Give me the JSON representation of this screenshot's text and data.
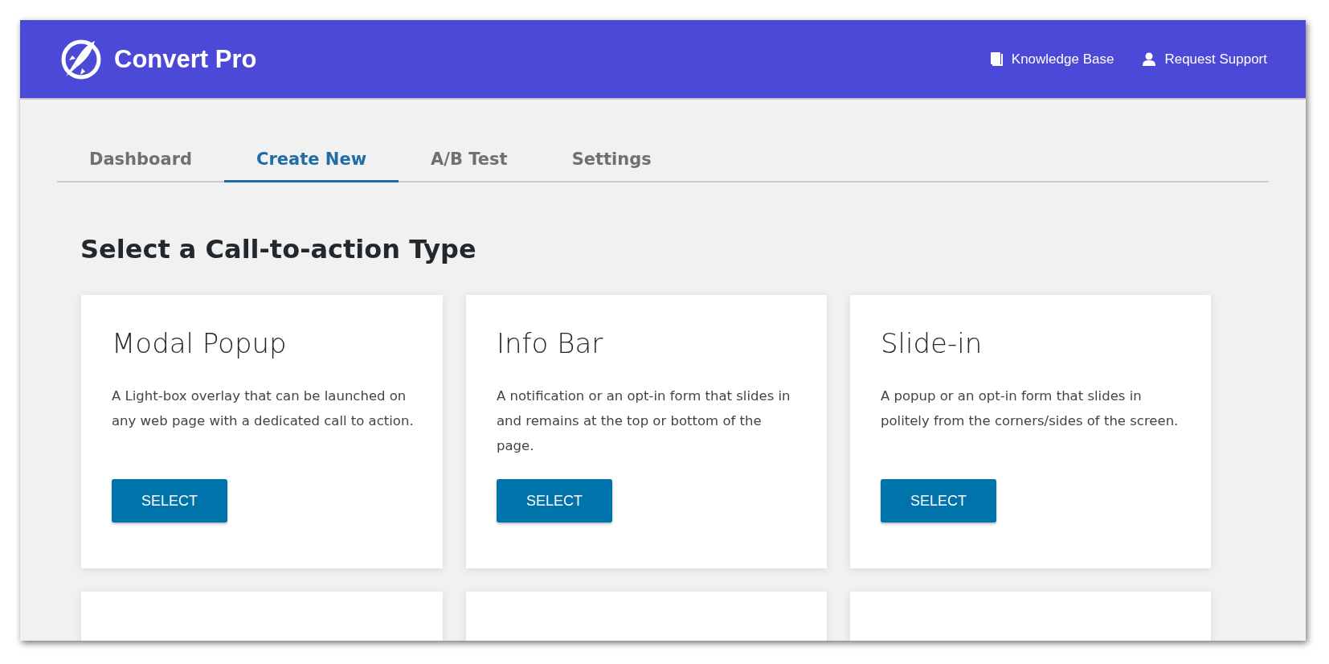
{
  "header": {
    "brand": "Convert Pro",
    "links": [
      {
        "kind": "book",
        "label": "Knowledge Base"
      },
      {
        "kind": "person",
        "label": "Request Support"
      }
    ]
  },
  "tabs": [
    {
      "label": "Dashboard",
      "selected": false
    },
    {
      "label": "Create New",
      "selected": true
    },
    {
      "label": "A/B Test",
      "selected": false
    },
    {
      "label": "Settings",
      "selected": false
    }
  ],
  "heading": "Select a Call-to-action Type",
  "cards": [
    {
      "kind": "type",
      "title": "Modal Popup",
      "description": "A Light-box overlay that can be launched on any web page with a dedicated call to action.",
      "button": "SELECT"
    },
    {
      "kind": "type",
      "title": "Info Bar",
      "description": "A notification or an opt-in form that slides in and remains at the top or bottom of the page.",
      "button": "SELECT"
    },
    {
      "kind": "type",
      "title": "Slide-in",
      "description": "A popup or an opt-in form that slides in politely from the corners/sides of the screen.",
      "button": "SELECT"
    },
    {
      "kind": "cut_off"
    },
    {
      "kind": "cut_off"
    },
    {
      "kind": "cut_off"
    }
  ]
}
